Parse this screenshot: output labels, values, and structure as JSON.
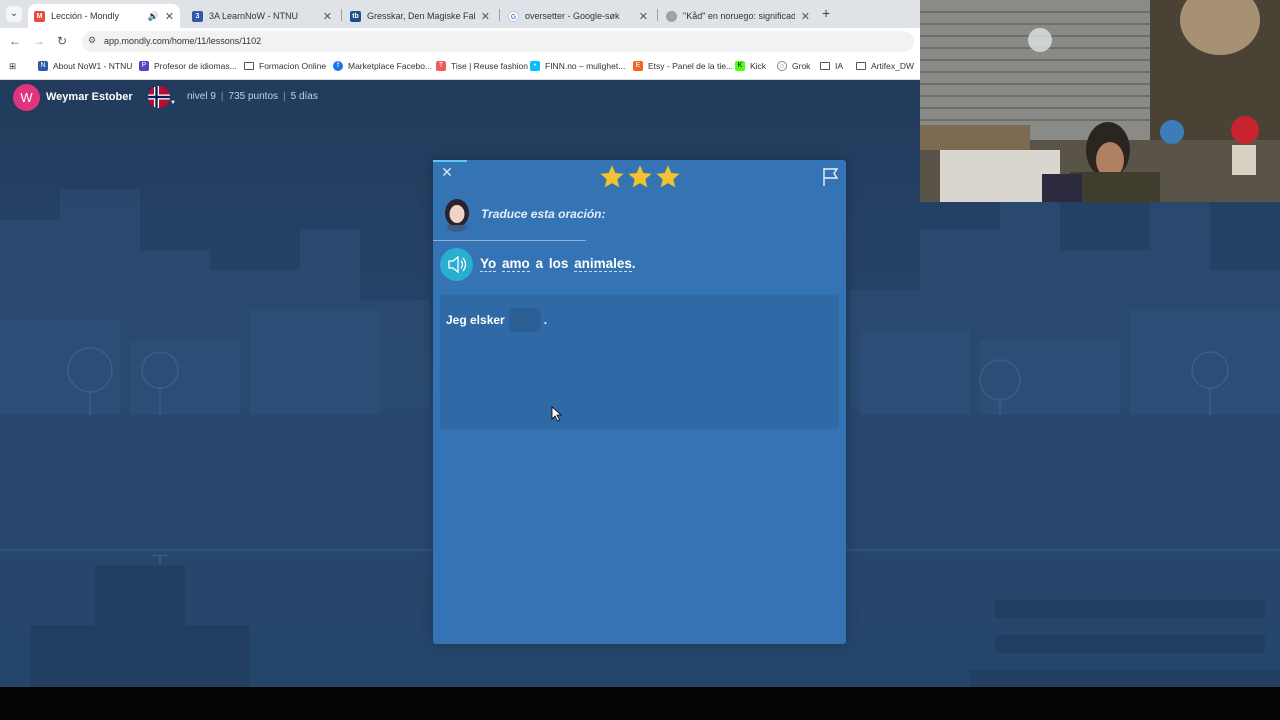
{
  "browser": {
    "tabs": [
      {
        "title": "Lección - Mondly",
        "favicon_color": "#e84c3d",
        "active": true,
        "audio": true
      },
      {
        "title": "3A LearnNoW - NTNU",
        "favicon_color": "#2f5aa8",
        "active": false
      },
      {
        "title": "Gresskar, Den Magiske Fabrikk...",
        "favicon_color": "#1d4f8f",
        "active": false
      },
      {
        "title": "oversetter - Google-søk",
        "favicon_color": "#4285f4",
        "active": false
      },
      {
        "title": "\"Kåd\" en noruego: significados...",
        "favicon_color": "#9aa0a6",
        "active": false
      }
    ],
    "new_tab_label": "+",
    "url": "app.mondly.com/home/11/lessons/1102",
    "bookmarks": [
      {
        "label": "About NoW1 - NTNU",
        "icon_color": "#2f5aa8"
      },
      {
        "label": "Profesor de idiomas...",
        "icon_color": "#5b3fc4"
      },
      {
        "label": "Formacion Online",
        "icon_color": "folder"
      },
      {
        "label": "Marketplace Facebo...",
        "icon_color": "#1877f2"
      },
      {
        "label": "Tise | Reuse fashion",
        "icon_color": "#f05a5a"
      },
      {
        "label": "FINN.no – mulighet...",
        "icon_color": "#06bffc"
      },
      {
        "label": "Etsy - Panel de la tie...",
        "icon_color": "#f1641e"
      },
      {
        "label": "Kick",
        "icon_color": "#53fc18"
      },
      {
        "label": "Grok",
        "icon_color": "#ffffff"
      },
      {
        "label": "IA",
        "icon_color": "folder"
      },
      {
        "label": "Artifex_DW",
        "icon_color": "folder"
      }
    ]
  },
  "user": {
    "avatar_initial": "W",
    "avatar_color": "#e0357c",
    "name": "Weymar Estober",
    "language_flag": "norway-flag",
    "level": "nivel 9",
    "points": "735 puntos",
    "streak": "5 días"
  },
  "lesson": {
    "stars": 3,
    "instruction": "Traduce esta oración:",
    "sentence_words": [
      "Yo",
      "amo",
      "a",
      "los",
      "animales"
    ],
    "sentence_end": ".",
    "answer_prefix": "Jeg elsker",
    "answer_suffix": ".",
    "colors": {
      "card": "#3474b5",
      "accent": "#29aed0",
      "star": "#f2c12e"
    }
  }
}
